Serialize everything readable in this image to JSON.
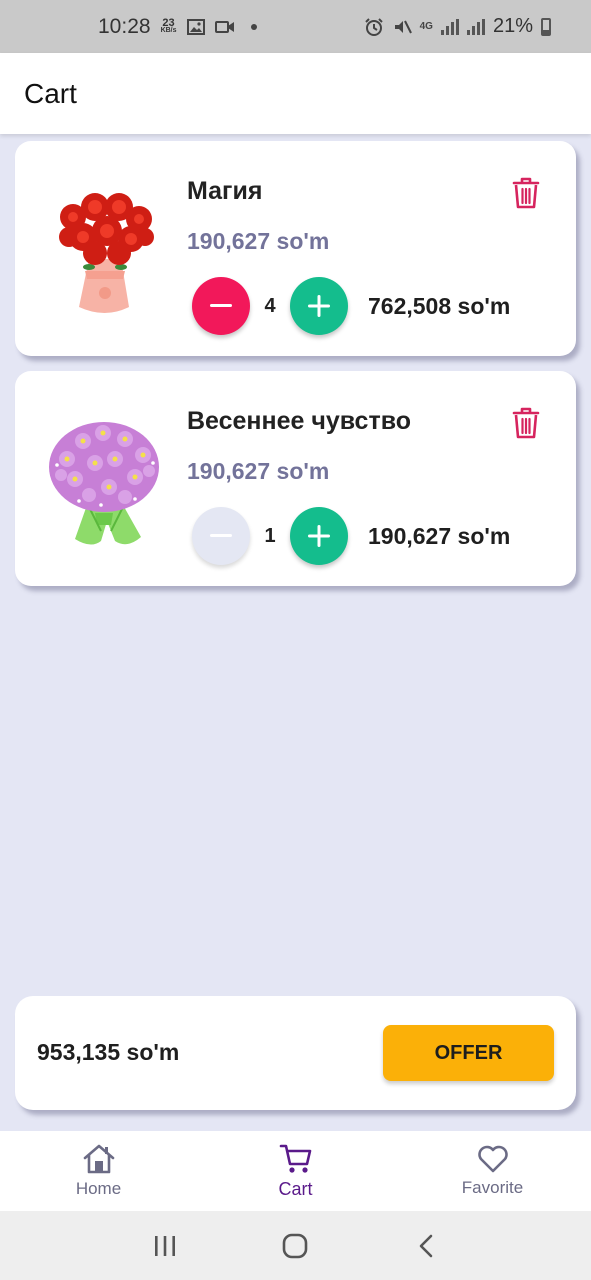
{
  "status_bar": {
    "time": "10:28",
    "speed_value": "23",
    "speed_unit": "KB/s",
    "network": "4G",
    "battery": "21%",
    "icons": [
      "gallery-icon",
      "video-icon",
      "dot-icon",
      "alarm-icon",
      "mute-icon",
      "data-arrows-icon",
      "signal-icon",
      "battery-icon"
    ]
  },
  "app_bar": {
    "title": "Cart"
  },
  "cart": {
    "items": [
      {
        "name": "Магия",
        "price": "190,627 so'm",
        "quantity": "4",
        "total": "762,508 so'm",
        "image": "red-bouquet"
      },
      {
        "name": "Весеннее чувство",
        "price": "190,627 so'm",
        "quantity": "1",
        "total": "190,627 so'm",
        "image": "lilac-bouquet"
      }
    ]
  },
  "summary": {
    "total": "953,135 so'm",
    "offer_label": "OFFER"
  },
  "bottom_nav": {
    "items": [
      {
        "label": "Home",
        "icon": "home-icon",
        "active": false
      },
      {
        "label": "Cart",
        "icon": "cart-icon",
        "active": true
      },
      {
        "label": "Favorite",
        "icon": "heart-icon",
        "active": false
      }
    ]
  },
  "colors": {
    "background": "#e4e6f4",
    "minus_active": "#f2185a",
    "plus": "#14bd8d",
    "price": "#73739a",
    "offer": "#fbb008",
    "nav_active": "#5a1a8a",
    "delete": "#d6245e"
  }
}
